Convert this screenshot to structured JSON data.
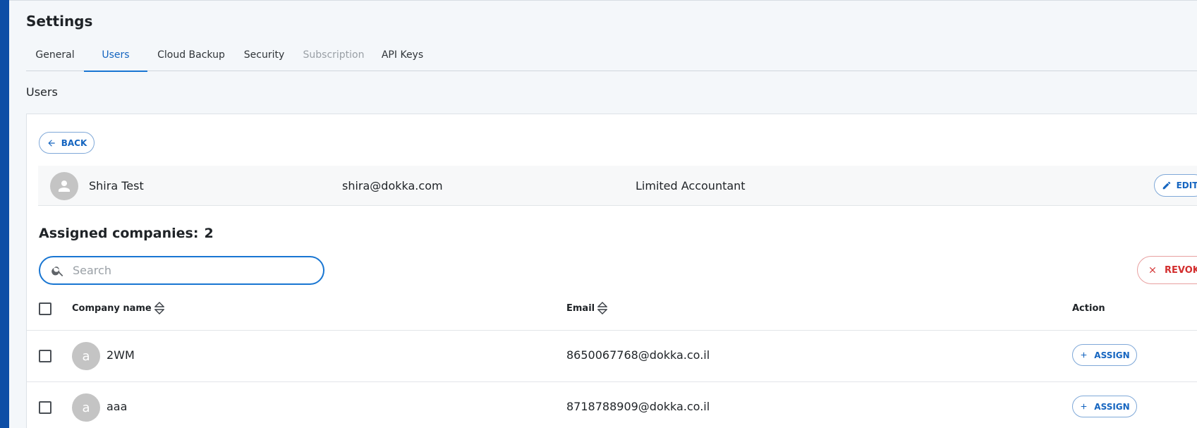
{
  "app": {
    "rail_color": "#0d4ea6",
    "accent": "#1976d2",
    "danger": "#d32f2f"
  },
  "header": {
    "title": "Settings"
  },
  "tabs": [
    {
      "label": "General",
      "state": "normal"
    },
    {
      "label": "Users",
      "state": "active"
    },
    {
      "label": "Cloud Backup",
      "state": "normal"
    },
    {
      "label": "Security",
      "state": "normal"
    },
    {
      "label": "Subscription",
      "state": "disabled"
    },
    {
      "label": "API Keys",
      "state": "normal"
    }
  ],
  "section": {
    "label": "Users"
  },
  "back_button": {
    "label": "BACK",
    "icon": "arrow-left-icon"
  },
  "user": {
    "avatar_icon": "person-icon",
    "name": "Shira Test",
    "email": "shira@dokka.com",
    "role": "Limited Accountant",
    "edit_label": "EDIT",
    "edit_icon": "pencil-icon"
  },
  "assigned": {
    "label": "Assigned companies:",
    "count": "2"
  },
  "search": {
    "placeholder": "Search",
    "value": "",
    "icon": "search-icon"
  },
  "revoke_button": {
    "label": "REVOK",
    "icon": "close-icon"
  },
  "table": {
    "columns": {
      "company": "Company name",
      "email": "Email",
      "action": "Action"
    },
    "rows": [
      {
        "avatar_letter": "a",
        "company": "2WM",
        "email": "8650067768@dokka.co.il",
        "action_label": "ASSIGN"
      },
      {
        "avatar_letter": "a",
        "company": "aaa",
        "email": "8718788909@dokka.co.il",
        "action_label": "ASSIGN"
      }
    ]
  }
}
